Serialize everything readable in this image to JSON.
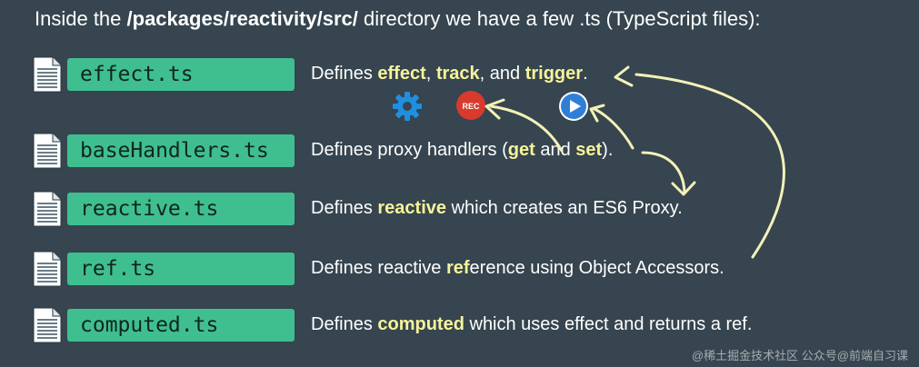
{
  "intro": {
    "prefix": "Inside the ",
    "path": "/packages/reactivity/src/",
    "suffix": " directory we have a few .ts (TypeScript files):"
  },
  "files": [
    {
      "name": "effect.ts",
      "d0": "Defines ",
      "h0": "effect",
      "d1": ", ",
      "h1": "track",
      "d2": ", and ",
      "h2": "trigger",
      "d3": "."
    },
    {
      "name": "baseHandlers.ts",
      "d0": "Defines proxy handlers (",
      "h0": "get",
      "d1": " and ",
      "h1": "set",
      "d2": ")."
    },
    {
      "name": "reactive.ts",
      "d0": "Defines ",
      "h0": "reactive",
      "d1": " which creates an ES6 Proxy."
    },
    {
      "name": "ref.ts",
      "d0": "Defines reactive ",
      "h0": "ref",
      "d1": "erence using Object Accessors."
    },
    {
      "name": "computed.ts",
      "d0": "Defines ",
      "h0": "computed",
      "d1": " which uses effect and returns a ref."
    }
  ],
  "icons": {
    "gear": "gear-icon",
    "rec": "REC",
    "play": "play-icon"
  },
  "colors": {
    "background": "#36454f",
    "pill": "#3fbf8f",
    "highlight": "#f7f39a",
    "arrow": "#f4f1b8",
    "rec": "#d83a2c",
    "play": "#2f7fd8"
  },
  "watermark": "@稀土掘金技术社区 公众号@前端自习课"
}
